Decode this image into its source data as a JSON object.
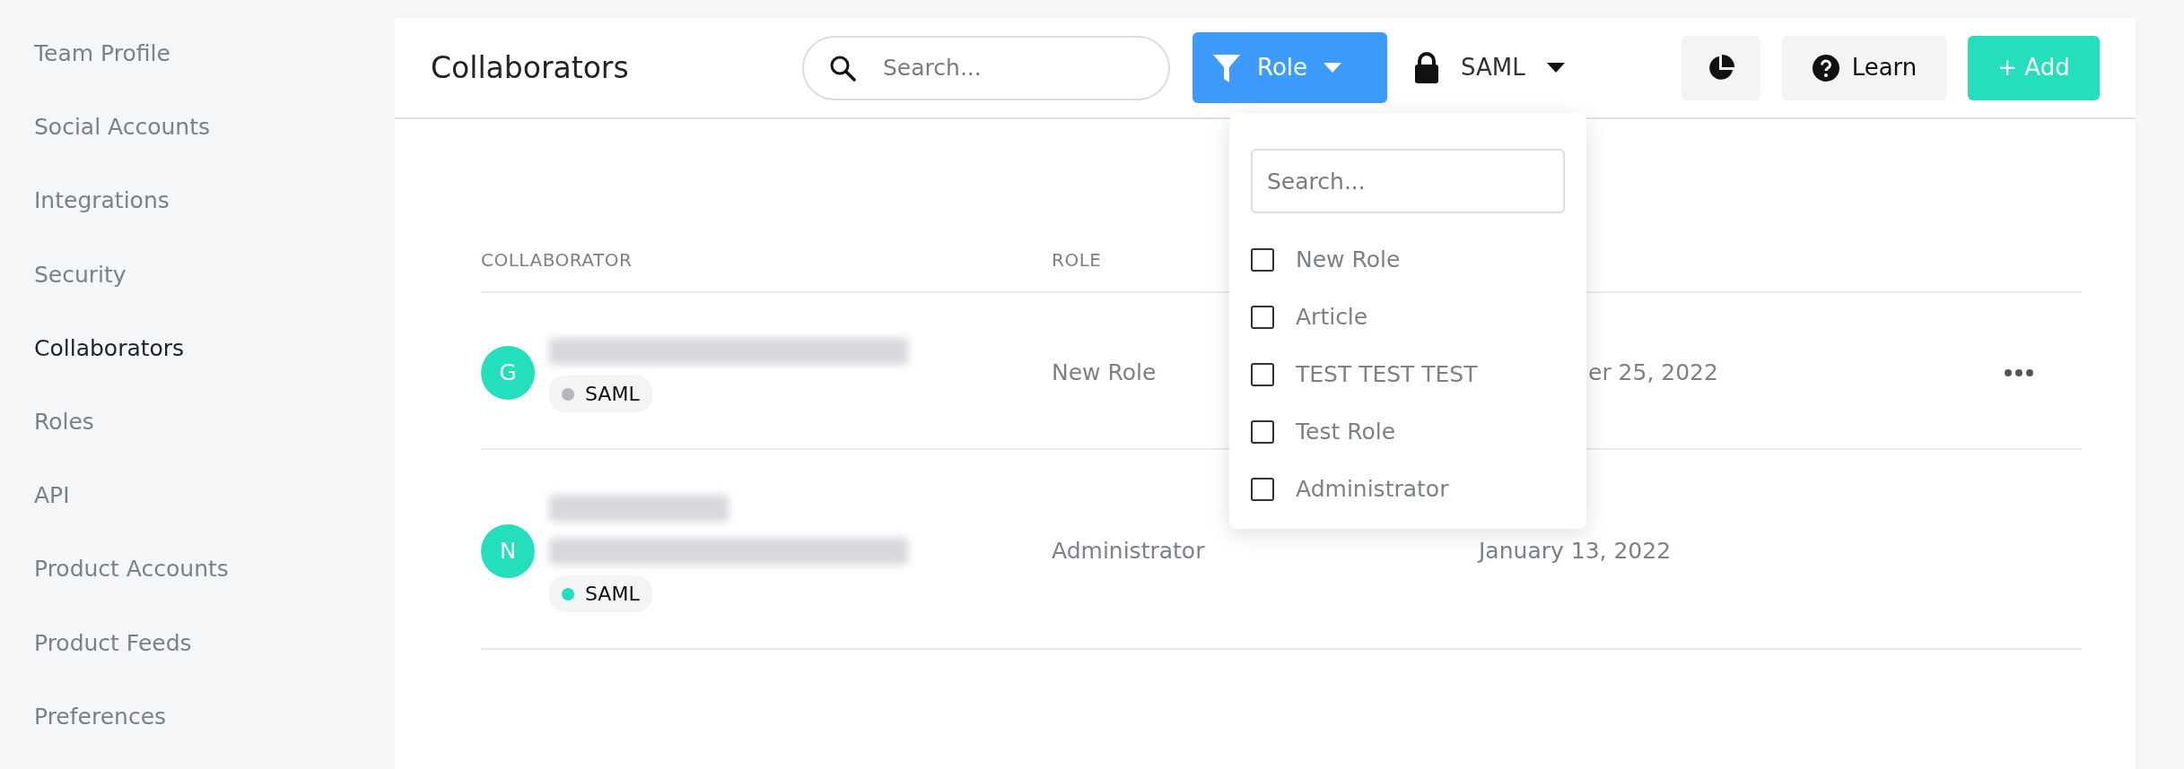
{
  "sidebar": {
    "items": [
      {
        "label": "Team Profile",
        "selected": false
      },
      {
        "label": "Social Accounts",
        "selected": false
      },
      {
        "label": "Integrations",
        "selected": false
      },
      {
        "label": "Security",
        "selected": false
      },
      {
        "label": "Collaborators",
        "selected": true
      },
      {
        "label": "Roles",
        "selected": false
      },
      {
        "label": "API",
        "selected": false
      },
      {
        "label": "Product Accounts",
        "selected": false
      },
      {
        "label": "Product Feeds",
        "selected": false
      },
      {
        "label": "Preferences",
        "selected": false
      }
    ]
  },
  "header": {
    "title": "Collaborators",
    "search": {
      "placeholder": "Search..."
    },
    "role_filter": {
      "label": "Role",
      "expanded": true
    },
    "saml_filter": {
      "label": "SAML"
    },
    "learn_button": "Learn",
    "add_button": "+ Add"
  },
  "role_menu": {
    "search": {
      "placeholder": "Search..."
    },
    "options": [
      {
        "label": "New Role",
        "checked": false
      },
      {
        "label": "Article",
        "checked": false
      },
      {
        "label": "TEST TEST TEST",
        "checked": false
      },
      {
        "label": "Test Role",
        "checked": false
      },
      {
        "label": "Administrator",
        "checked": false
      }
    ]
  },
  "table": {
    "columns": [
      "COLLABORATOR",
      "ROLE"
    ],
    "rows": [
      {
        "initial": "G",
        "blurred": [
          {
            "kind": "email"
          }
        ],
        "badge": {
          "label": "SAML",
          "color": "#b4b7bb"
        },
        "role": "New Role",
        "date": "er 25, 2022",
        "date_covered": true,
        "has_menu": true
      },
      {
        "initial": "N",
        "blurred": [
          {
            "kind": "name"
          },
          {
            "kind": "email"
          }
        ],
        "badge": {
          "label": "SAML",
          "color": "#24dfbb"
        },
        "role": "Administrator",
        "date": "January 13, 2022",
        "date_covered": false,
        "has_menu": false
      }
    ]
  }
}
